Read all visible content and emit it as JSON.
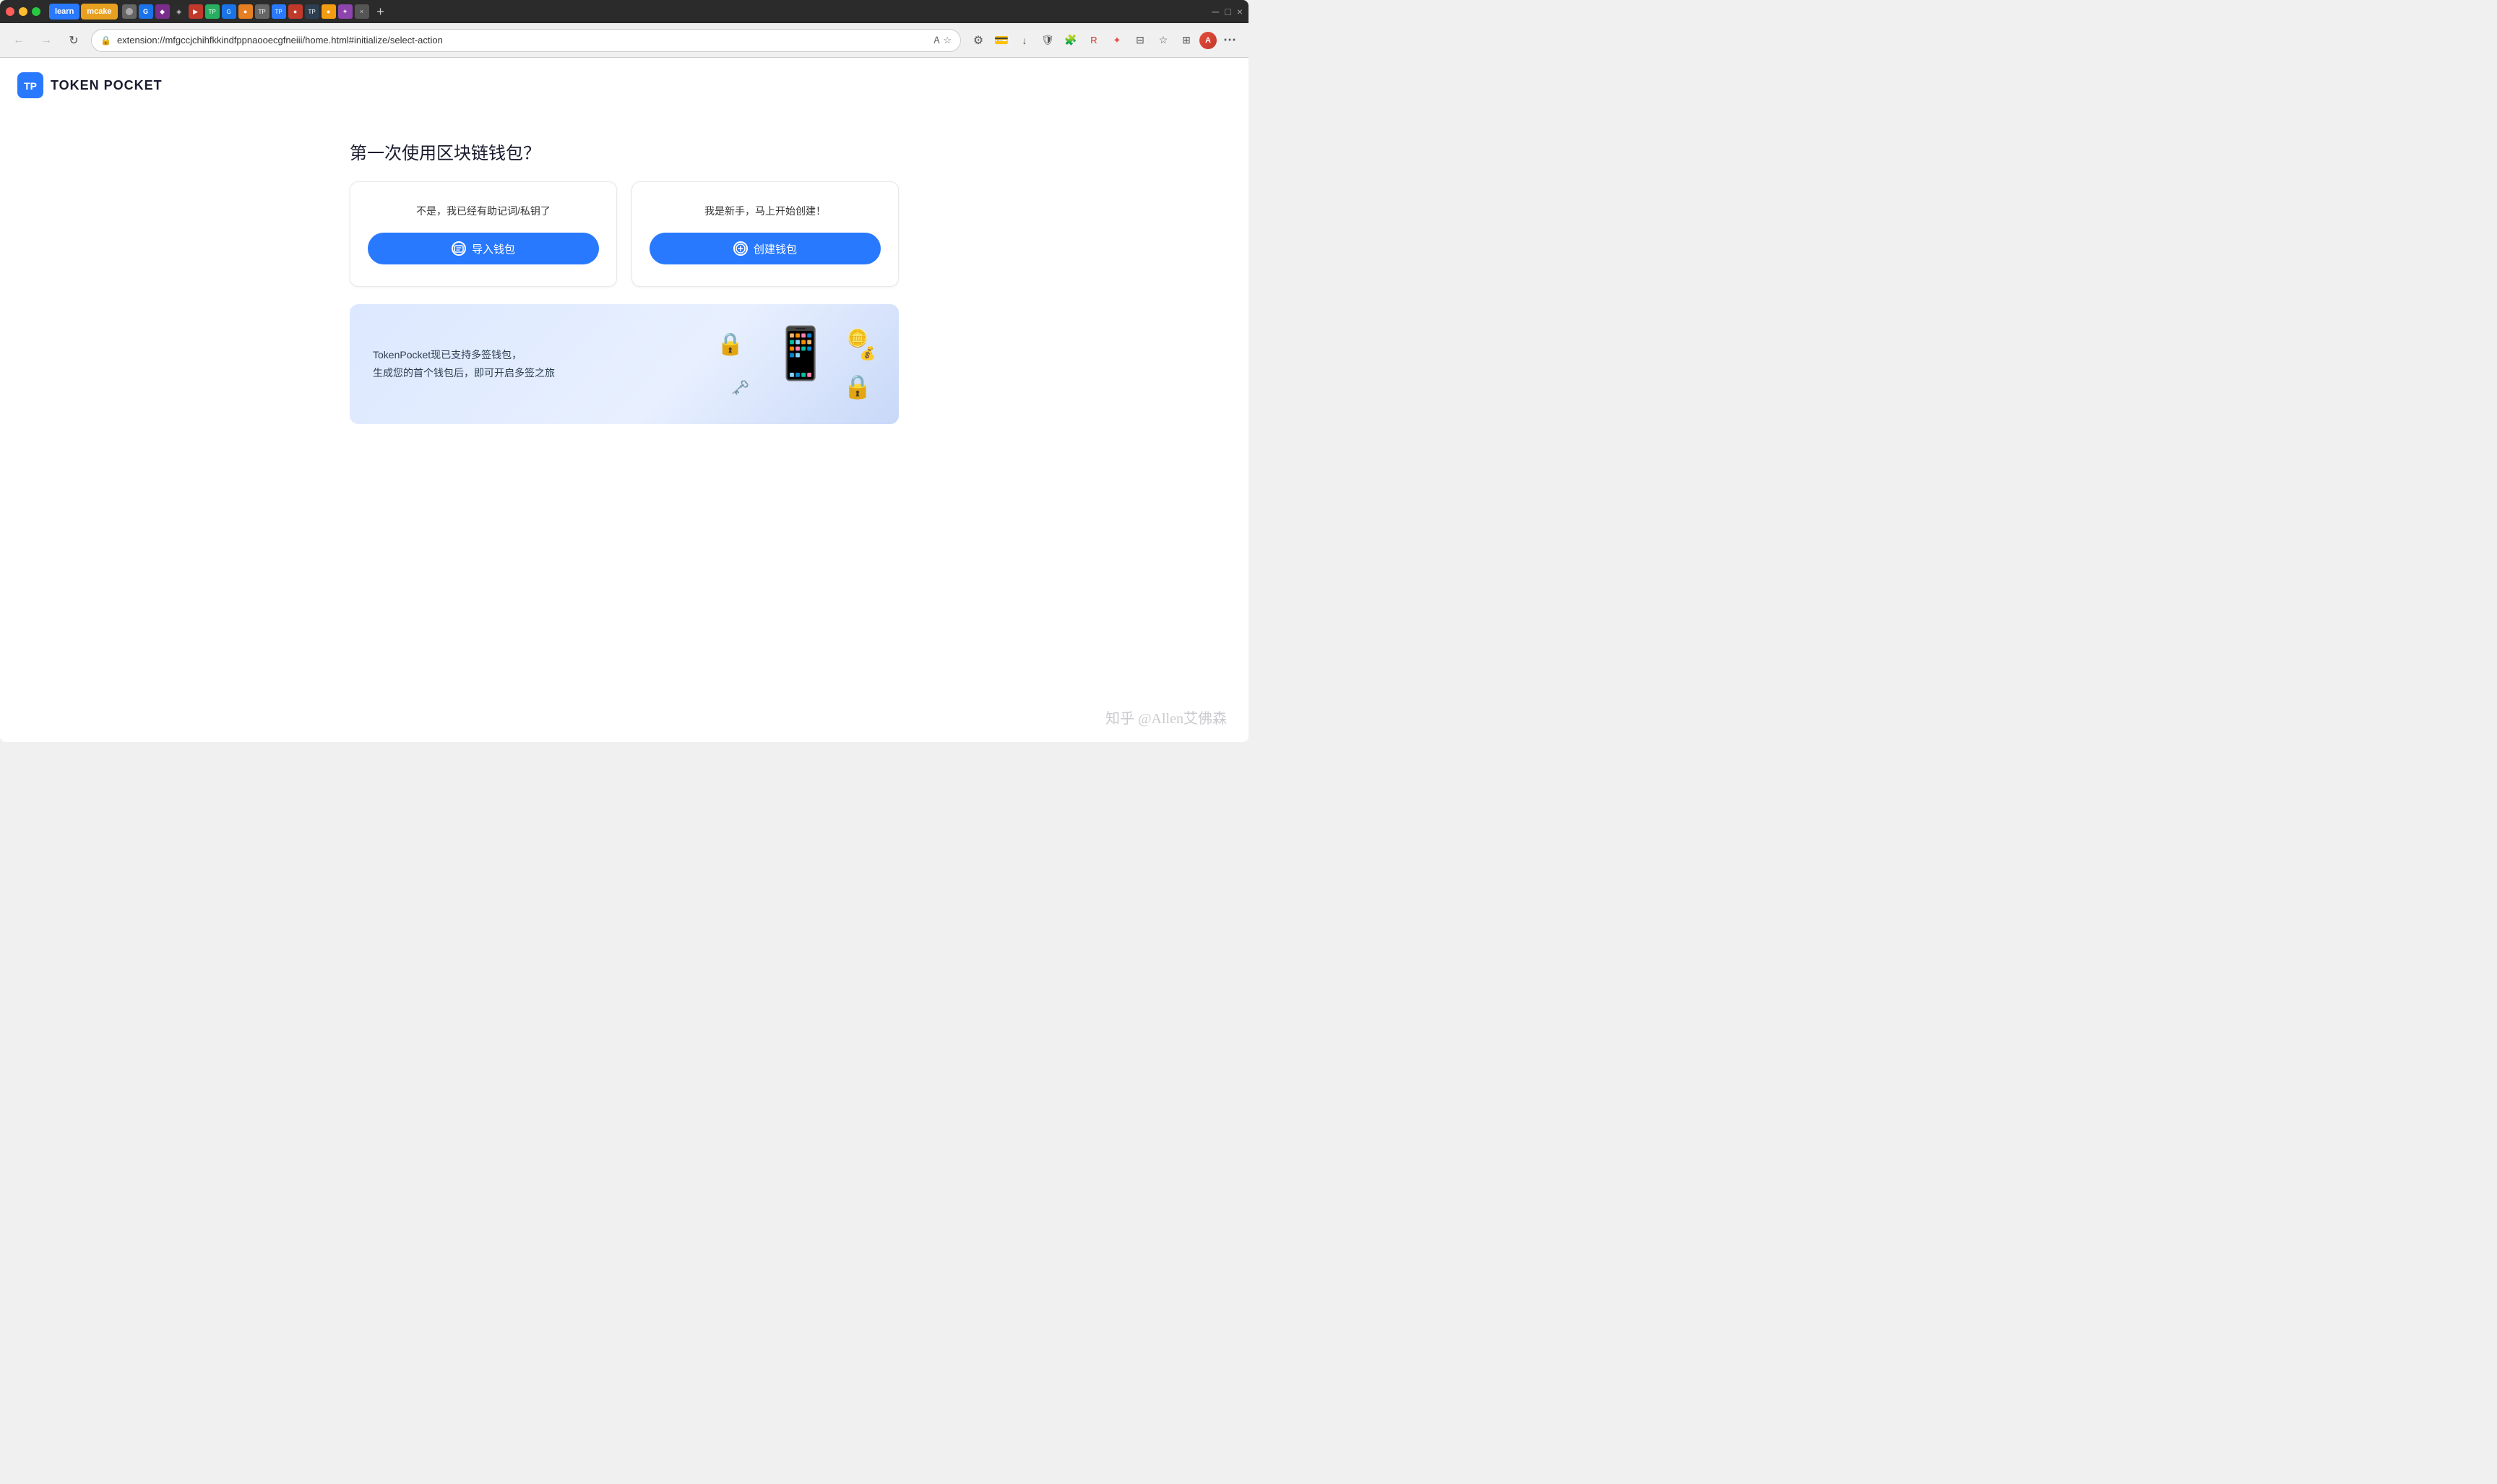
{
  "browser": {
    "tabs": [
      {
        "id": "learn",
        "label": "learn",
        "color": "#2979ff",
        "active": false
      },
      {
        "id": "mcake",
        "label": "mcake",
        "color": "#ff6b35",
        "active": false
      },
      {
        "id": "t1",
        "label": "",
        "color": "#555",
        "active": false
      },
      {
        "id": "t2",
        "label": "",
        "color": "#1a73e8",
        "active": false
      },
      {
        "id": "t3",
        "label": "",
        "color": "#6c3483",
        "active": false
      },
      {
        "id": "t4",
        "label": "",
        "color": "#2c3e50",
        "active": false
      },
      {
        "id": "t5",
        "label": "",
        "color": "#27ae60",
        "active": false
      },
      {
        "id": "t6",
        "label": "",
        "color": "#e74c3c",
        "active": false
      },
      {
        "id": "tp-active",
        "label": "TokenPocket",
        "color": "#2979ff",
        "active": true
      }
    ],
    "address": "extension://mfgccjchihfkkindfppnaooecgfneiii/home.html#initialize/select-action",
    "lock_icon": "🔒"
  },
  "page": {
    "logo_text": "TOKEN POCKET",
    "title": "第一次使用区块链钱包？",
    "card_import": {
      "subtitle": "不是，我已经有助记词/私钥了",
      "button_label": "导入钱包"
    },
    "card_create": {
      "subtitle": "我是新手，马上开始创建！",
      "button_label": "创建钱包"
    },
    "banner": {
      "line1": "TokenPocket现已支持多签钱包，",
      "line2": "生成您的首个钱包后，即可开启多签之旅"
    },
    "watermark": "知乎 @Allen艾佛森"
  }
}
